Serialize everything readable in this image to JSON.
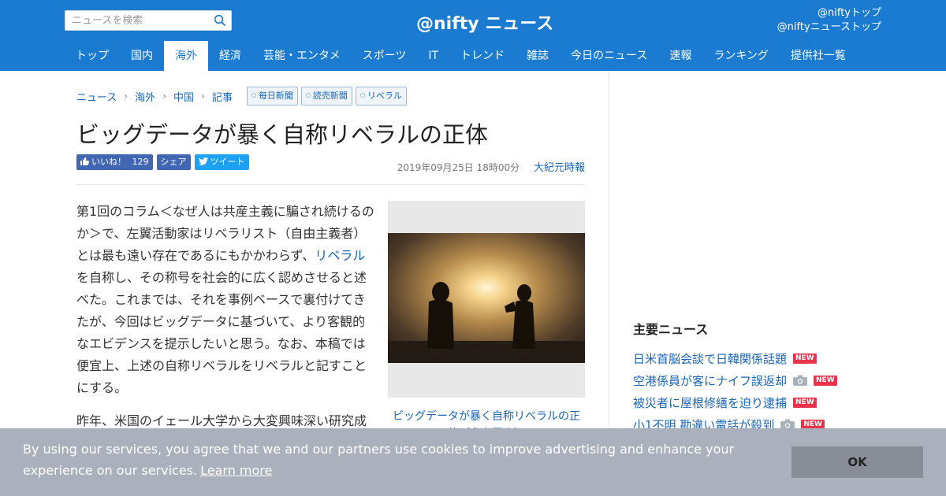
{
  "header": {
    "search_placeholder": "ニュースを検索",
    "logo_text": "@nifty ニュース",
    "top_links": [
      "@niftyトップ",
      "@niftyニューストップ"
    ]
  },
  "nav": {
    "items": [
      "トップ",
      "国内",
      "海外",
      "経済",
      "芸能・エンタメ",
      "スポーツ",
      "IT",
      "トレンド",
      "雑誌",
      "今日のニュース",
      "速報",
      "ランキング",
      "提供社一覧"
    ],
    "active": "海外"
  },
  "breadcrumb": [
    "ニュース",
    "海外",
    "中国",
    "記事"
  ],
  "tags": [
    "毎日新聞",
    "読売新聞",
    "リベラル"
  ],
  "article": {
    "title": "ビッグデータが暴く自称リベラルの正体",
    "like_label": "いいね！",
    "like_count": "129",
    "share_label": "シェア",
    "tweet_label": "ツイート",
    "date": "2019年09月25日 18時00分",
    "source": "大紀元時報",
    "p1_a": "第1回のコラム＜なぜ人は共産主義に騙され続けるのか＞で、左翼活動家はリベラリスト（自由主義者）とは最も遠い存在であるにもかかわらず、",
    "p1_link": "リベラル",
    "p1_b": "を自称し、その称号を社会的に広く認めさせると述べた。これまでは、それを事例ベースで裏付けてきたが、今回はビッグデータに基づいて、より客観的なエビデンスを提示したいと思う。なお、本稿では便宜上、上述の自称リベラルをリベラルと記すことにする。",
    "p2": "昨年、米国のイェール大学から大変興味深い研究成",
    "caption": "ビッグデータが暴く自称リベラルの正体（参考写真）"
  },
  "sidebar": {
    "heading": "主要ニュース",
    "new_label": "NEW",
    "items": [
      {
        "text": "日米首脳会談で日韓関係話題",
        "camera": false
      },
      {
        "text": "空港係員が客にナイフ誤返却",
        "camera": true
      },
      {
        "text": "被災者に屋根修繕を迫り逮捕",
        "camera": false
      },
      {
        "text": "小1不明 勘違い電話が殺到",
        "camera": true
      }
    ]
  },
  "cookie": {
    "message": "By using our services, you agree that we and our partners use cookies to improve advertising and enhance your experience on our services.",
    "learn_more": "Learn more",
    "ok": "OK"
  },
  "colors": {
    "brand_blue": "#1a7bd0",
    "link_blue": "#1a66b8",
    "new_badge": "#e8334a",
    "cookie_bg": "#aab0bc"
  }
}
